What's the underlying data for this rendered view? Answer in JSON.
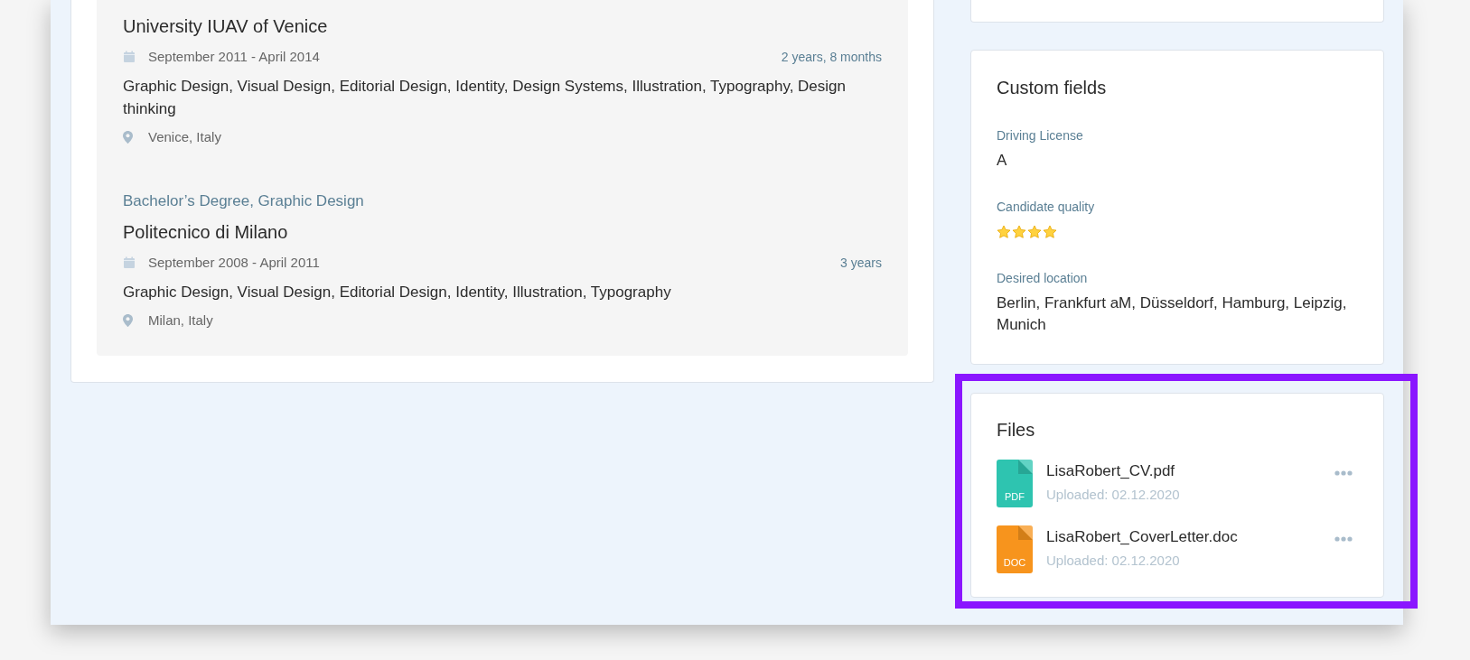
{
  "education": [
    {
      "school": "University IUAV of Venice",
      "dates": "September 2011 - April 2014",
      "duration": "2 years, 8 months",
      "skills": "Graphic Design, Visual Design, Editorial Design, Identity, Design Systems, Illustration, Typography, Design thinking",
      "location": "Venice, Italy"
    },
    {
      "degree": "Bachelor’s Degree, Graphic Design",
      "school": "Politecnico di Milano",
      "dates": "September 2008 - April 2011",
      "duration": "3 years",
      "skills": "Graphic Design, Visual Design, Editorial Design, Identity, Illustration, Typography",
      "location": "Milan, Italy"
    }
  ],
  "custom_fields": {
    "title": "Custom fields",
    "fields": [
      {
        "kind": "text",
        "label": "Driving License",
        "value": "A"
      },
      {
        "kind": "rating",
        "label": "Candidate quality",
        "stars": 4
      },
      {
        "kind": "text",
        "label": "Desired location",
        "value": "Berlin, Frankfurt aM, Düsseldorf, Hamburg, Leipzig, Munich"
      }
    ]
  },
  "files": {
    "title": "Files",
    "highlighted": true,
    "items": [
      {
        "type_label": "PDF",
        "color": "#2ec4b0",
        "name": "LisaRobert_CV.pdf",
        "uploaded": "Uploaded: 02.12.2020"
      },
      {
        "type_label": "DOC",
        "color": "#f7941d",
        "name": "LisaRobert_CoverLetter.doc",
        "uploaded": "Uploaded: 02.12.2020"
      }
    ]
  }
}
